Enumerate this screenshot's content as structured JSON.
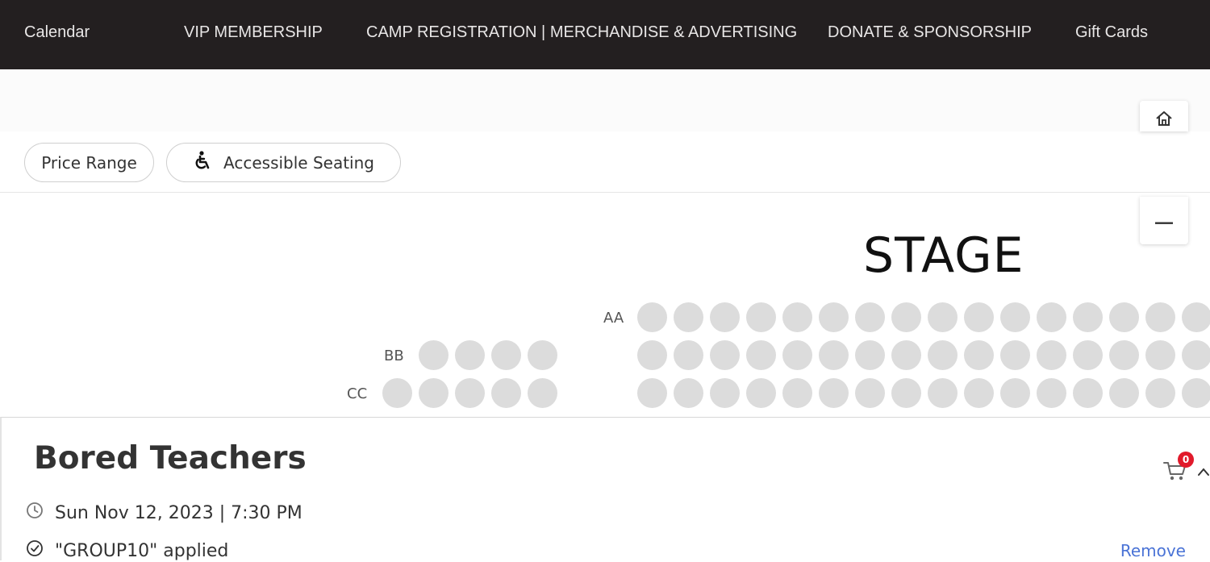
{
  "nav": {
    "items": [
      {
        "label": "Calendar",
        "name": "nav-calendar"
      },
      {
        "label": "VIP MEMBERSHIP",
        "name": "nav-vip-membership"
      },
      {
        "label": "CAMP REGISTRATION | MERCHANDISE & ADVERTISING",
        "name": "nav-camp-registration"
      },
      {
        "label": "DONATE & SPONSORSHIP",
        "name": "nav-donate-sponsorship"
      },
      {
        "label": "Gift Cards",
        "name": "nav-gift-cards"
      }
    ]
  },
  "filters": {
    "price_range": "Price Range",
    "accessible": "Accessible Seating",
    "accessible_icon": "wheelchair-icon"
  },
  "map_controls": {
    "home_icon": "home-icon",
    "zoom_out_icon": "minus-icon"
  },
  "seatmap": {
    "stage_label": "STAGE",
    "seat_color": "#dcdcdc",
    "rows": [
      {
        "label": "AA",
        "left_block_seats": 0,
        "right_block_seats": 16
      },
      {
        "label": "BB",
        "left_block_seats": 4,
        "right_block_seats": 16
      },
      {
        "label": "CC",
        "left_block_seats": 5,
        "right_block_seats": 16
      }
    ]
  },
  "event": {
    "title": "Bored Teachers",
    "datetime": "Sun Nov 12, 2023 | 7:30 PM",
    "promo": "\"GROUP10\" applied",
    "remove_label": "Remove",
    "cart_count": "0",
    "accent_color": "#4a73d6",
    "badge_color": "#e11a2b"
  }
}
